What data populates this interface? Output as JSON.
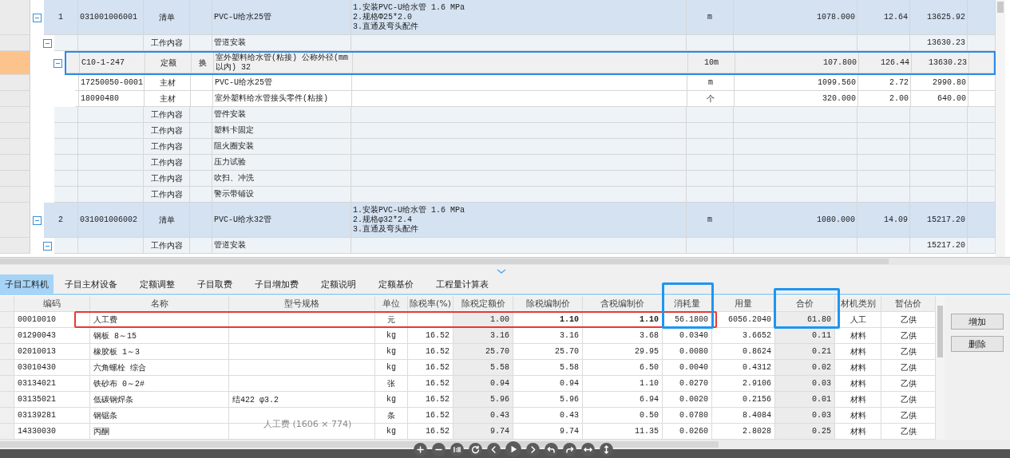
{
  "top_table": {
    "rows": [
      {
        "index": "1",
        "code": "031001006001",
        "type": "清单",
        "kind": "bill",
        "name": "PVC-U给水25管",
        "description": [
          "1.安装PVC-U给水管 1.6 MPa",
          "2.规格Φ25*2.0",
          "3.直通及弯头配件"
        ],
        "unit": "m",
        "quantity": "1078.000",
        "price": "12.64",
        "total": "13625.92",
        "expanded": true,
        "selected": false,
        "children": [
          {
            "type": "工作内容",
            "kind": "work",
            "name": "管道安装",
            "total": "13630.23",
            "expanded": true,
            "selected": false,
            "children": [
              {
                "code": "C10-1-247",
                "type": "定额",
                "kind": "quota",
                "mark": "换",
                "name": "室外塑料给水管(粘接) 公称外径(mm以内) 32",
                "unit": "10m",
                "quantity": "107.800",
                "price": "126.44",
                "total": "13630.23",
                "expanded": true,
                "selected": true,
                "children": [
                  {
                    "code": "17250050-0001",
                    "type": "主材",
                    "kind": "material",
                    "name": "PVC-U给水25管",
                    "unit": "m",
                    "quantity": "1099.560",
                    "price": "2.72",
                    "total": "2990.80",
                    "selected": false
                  },
                  {
                    "code": "18090480",
                    "type": "主材",
                    "kind": "material",
                    "name": "室外塑料给水管接头零件(粘接)",
                    "unit": "个",
                    "quantity": "320.000",
                    "price": "2.00",
                    "total": "640.00",
                    "selected": false
                  }
                ]
              }
            ]
          },
          {
            "type": "工作内容",
            "kind": "work",
            "name": "管件安装",
            "selected": false
          },
          {
            "type": "工作内容",
            "kind": "work",
            "name": "塑料卡固定",
            "selected": false
          },
          {
            "type": "工作内容",
            "kind": "work",
            "name": "阻火圈安装",
            "selected": false
          },
          {
            "type": "工作内容",
            "kind": "work",
            "name": "压力试验",
            "selected": false
          },
          {
            "type": "工作内容",
            "kind": "work",
            "name": "吹扫、冲洗",
            "selected": false
          },
          {
            "type": "工作内容",
            "kind": "work",
            "name": "警示带铺设",
            "selected": false
          }
        ]
      },
      {
        "index": "2",
        "code": "031001006002",
        "type": "清单",
        "kind": "bill",
        "name": "PVC-U给水32管",
        "description": [
          "1.安装PVC-U给水管 1.6 MPa",
          "2.规格φ32*2.4",
          "3.直通及弯头配件"
        ],
        "unit": "m",
        "quantity": "1080.000",
        "price": "14.09",
        "total": "15217.20",
        "expanded": true,
        "selected": false,
        "children": [
          {
            "type": "工作内容",
            "kind": "work",
            "name": "管道安装",
            "total": "15217.20",
            "expanded": true,
            "selected": false
          }
        ]
      }
    ]
  },
  "tabs": [
    {
      "label": "子目工料机",
      "selected": true
    },
    {
      "label": "子目主材设备",
      "selected": false
    },
    {
      "label": "定额调整",
      "selected": false
    },
    {
      "label": "子目取费",
      "selected": false
    },
    {
      "label": "子目增加费",
      "selected": false
    },
    {
      "label": "定额说明",
      "selected": false
    },
    {
      "label": "定额基价",
      "selected": false
    },
    {
      "label": "工程量计算表",
      "selected": false
    }
  ],
  "resource_table": {
    "columns": [
      "编码",
      "名称",
      "型号规格",
      "单位",
      "除税率(%)",
      "除税定额价",
      "除税编制价",
      "含税编制价",
      "消耗量",
      "用量",
      "合价",
      "材机类别",
      "暂估价"
    ],
    "rows": [
      {
        "bold": true,
        "cells": [
          "00010010",
          "人工费",
          "",
          "元",
          "",
          "1.00",
          "1.10",
          "1.10",
          "56.1800",
          "6056.2040",
          "61.80",
          "人工",
          "乙供"
        ]
      },
      {
        "bold": false,
        "cells": [
          "01290043",
          "钢板 8～15",
          "",
          "kg",
          "16.52",
          "3.16",
          "3.16",
          "3.68",
          "0.0340",
          "3.6652",
          "0.11",
          "材料",
          "乙供"
        ]
      },
      {
        "bold": false,
        "cells": [
          "02010013",
          "橡胶板 1～3",
          "",
          "kg",
          "16.52",
          "25.70",
          "25.70",
          "29.95",
          "0.0080",
          "0.8624",
          "0.21",
          "材料",
          "乙供"
        ]
      },
      {
        "bold": false,
        "cells": [
          "03010430",
          "六角螺栓 综合",
          "",
          "kg",
          "16.52",
          "5.58",
          "5.58",
          "6.50",
          "0.0040",
          "0.4312",
          "0.02",
          "材料",
          "乙供"
        ]
      },
      {
        "bold": false,
        "cells": [
          "03134021",
          "铁砂布 0～2#",
          "",
          "张",
          "16.52",
          "0.94",
          "0.94",
          "1.10",
          "0.0270",
          "2.9106",
          "0.03",
          "材料",
          "乙供"
        ]
      },
      {
        "bold": false,
        "cells": [
          "03135021",
          "低碳钢焊条",
          "结422 φ3.2",
          "kg",
          "16.52",
          "5.96",
          "5.96",
          "6.94",
          "0.0020",
          "0.2156",
          "0.01",
          "材料",
          "乙供"
        ]
      },
      {
        "bold": false,
        "cells": [
          "03139281",
          "钢锯条",
          "",
          "条",
          "16.52",
          "0.43",
          "0.43",
          "0.50",
          "0.0780",
          "8.4084",
          "0.03",
          "材料",
          "乙供"
        ]
      },
      {
        "bold": false,
        "cells": [
          "14330030",
          "丙酮",
          "",
          "kg",
          "16.52",
          "9.74",
          "9.74",
          "11.35",
          "0.0260",
          "2.8028",
          "0.25",
          "材料",
          "乙供"
        ]
      }
    ]
  },
  "side_buttons": [
    "增加",
    "删除"
  ],
  "viewer": {
    "caption": "人工费 (1606 × 774)"
  }
}
